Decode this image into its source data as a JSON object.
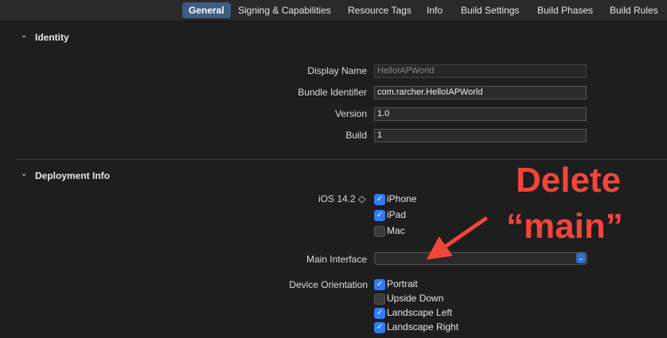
{
  "tabs": [
    {
      "label": "General",
      "active": true
    },
    {
      "label": "Signing & Capabilities"
    },
    {
      "label": "Resource Tags"
    },
    {
      "label": "Info"
    },
    {
      "label": "Build Settings"
    },
    {
      "label": "Build Phases"
    },
    {
      "label": "Build Rules"
    }
  ],
  "identity": {
    "title": "Identity",
    "display_name_label": "Display Name",
    "display_name_placeholder": "HelloIAPWorld",
    "bundle_id_label": "Bundle Identifier",
    "bundle_id_value": "com.rarcher.HelloIAPWorld",
    "version_label": "Version",
    "version_value": "1.0",
    "build_label": "Build",
    "build_value": "1"
  },
  "deployment": {
    "title": "Deployment Info",
    "os_label": "iOS 14.2 ◇",
    "devices": [
      {
        "label": "iPhone",
        "checked": true
      },
      {
        "label": "iPad",
        "checked": true
      },
      {
        "label": "Mac",
        "checked": false
      }
    ],
    "main_interface_label": "Main Interface",
    "main_interface_value": "",
    "orientation_label": "Device Orientation",
    "orientations": [
      {
        "label": "Portrait",
        "checked": true
      },
      {
        "label": "Upside Down",
        "checked": false
      },
      {
        "label": "Landscape Left",
        "checked": true
      },
      {
        "label": "Landscape Right",
        "checked": true
      }
    ]
  },
  "annotation": {
    "line1": "Delete",
    "line2": "“main”",
    "color": "#f0463c"
  }
}
